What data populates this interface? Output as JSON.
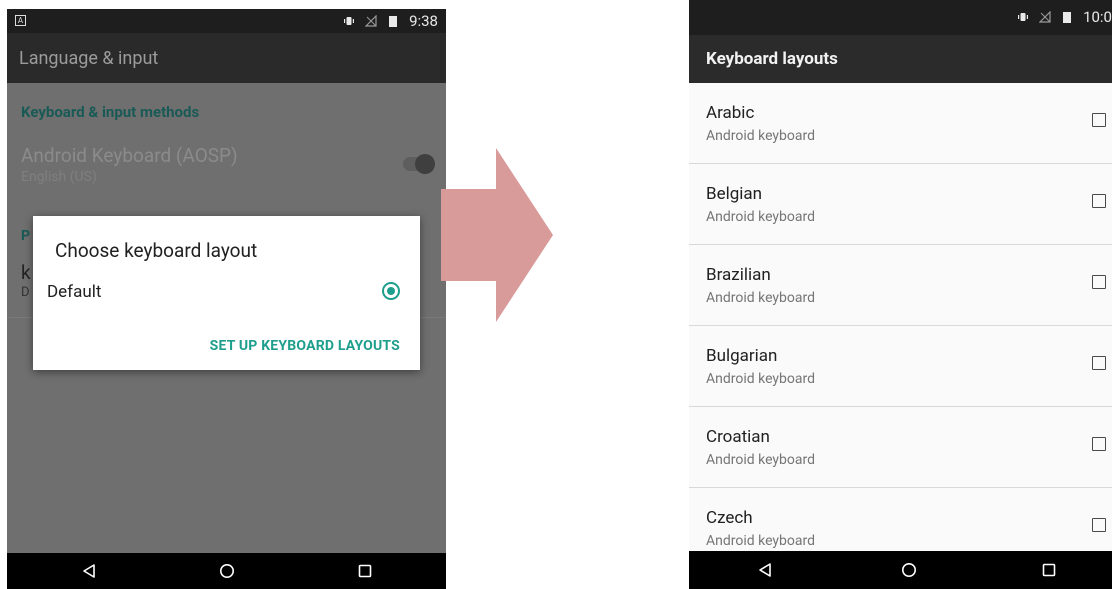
{
  "left_screen": {
    "status_time": "9:38",
    "status_badge": "A",
    "toolbar_title": "Language & input",
    "section_header": "Keyboard & input methods",
    "keyboard_item_title": "Android Keyboard (AOSP)",
    "keyboard_item_sub": "English (US)",
    "obscured_frag_1": "P",
    "obscured_frag_2": "k",
    "obscured_frag_3": "D",
    "dialog": {
      "title": "Choose keyboard layout",
      "option": "Default",
      "action": "SET UP KEYBOARD LAYOUTS"
    }
  },
  "right_screen": {
    "status_time": "10:0",
    "toolbar_title": "Keyboard layouts",
    "layouts": [
      {
        "name": "Arabic",
        "sub": "Android keyboard"
      },
      {
        "name": "Belgian",
        "sub": "Android keyboard"
      },
      {
        "name": "Brazilian",
        "sub": "Android keyboard"
      },
      {
        "name": "Bulgarian",
        "sub": "Android keyboard"
      },
      {
        "name": "Croatian",
        "sub": "Android keyboard"
      },
      {
        "name": "Czech",
        "sub": "Android keyboard"
      }
    ]
  },
  "colors": {
    "accent": "#1e9e8c",
    "arrow": "#d99a9a",
    "dark_toolbar": "#2b2b2b"
  },
  "icons": [
    "vibrate-icon",
    "no-signal-icon",
    "battery-icon",
    "back-icon",
    "home-icon",
    "recents-icon",
    "radio-selected-icon",
    "checkbox-icon",
    "transition-arrow-icon"
  ]
}
